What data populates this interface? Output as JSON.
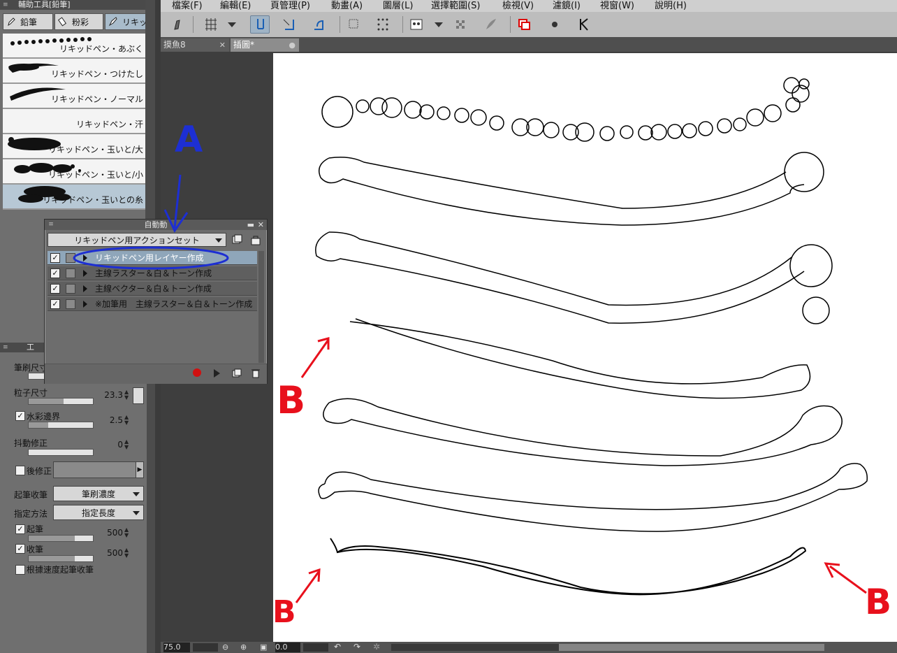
{
  "subtool_panel": {
    "title": "輔助工具[鉛筆]",
    "tabs": [
      {
        "label": "鉛筆",
        "icon": "pencil-icon"
      },
      {
        "label": "粉彩",
        "icon": "pastel-icon"
      },
      {
        "label": "リキッ",
        "icon": "liquid-pen-icon"
      }
    ],
    "brushes": [
      {
        "name": "リキッドペン・あぶく"
      },
      {
        "name": "リキッドペン・つけたし"
      },
      {
        "name": "リキッドペン・ノーマル"
      },
      {
        "name": "リキッドペン・汗"
      },
      {
        "name": "リキッドペン・玉いと/大"
      },
      {
        "name": "リキッドペン・玉いと/小"
      },
      {
        "name": "リキッドペン・玉いとの糸"
      }
    ]
  },
  "tool_property": {
    "title": "工",
    "brush_size_label": "筆刷尺寸",
    "particle_size_label": "粒子尺寸",
    "particle_size_value": "23.3",
    "watercolor_edge_label": "水彩邊界",
    "watercolor_edge_value": "2.5",
    "stabilization_label": "抖動修正",
    "stabilization_value": "0",
    "post_correction_label": "後修正",
    "taper_label": "起筆收筆",
    "taper_value": "筆刷濃度",
    "method_label": "指定方法",
    "method_value": "指定長度",
    "start_label": "起筆",
    "start_value": "500",
    "end_label": "收筆",
    "end_value": "500",
    "speed_taper_label": "根據速度起筆收筆"
  },
  "menubar": [
    "檔案(F)",
    "編輯(E)",
    "頁管理(P)",
    "動畫(A)",
    "圖層(L)",
    "選擇範圍(S)",
    "檢視(V)",
    "濾鏡(I)",
    "視窗(W)",
    "說明(H)"
  ],
  "doc_tabs": [
    {
      "label": "摸魚8",
      "active": false
    },
    {
      "label": "插圖*",
      "active": true
    }
  ],
  "auto_action": {
    "title": "自動動",
    "set_name": "リキッドペン用アクションセット",
    "actions": [
      {
        "label": "リキッドペン用レイヤー作成",
        "selected": true
      },
      {
        "label": "主線ラスター＆白＆トーン作成",
        "selected": false
      },
      {
        "label": "主線ベクター＆白＆トーン作成",
        "selected": false
      },
      {
        "label": "※加筆用　主線ラスター＆白＆トーン作成",
        "selected": false
      }
    ]
  },
  "status": {
    "zoom": "75.0",
    "angle": "0.0"
  },
  "annotations": {
    "a_label": "A",
    "b_label": "B"
  },
  "colors": {
    "annotation_blue": "#1d2fd3",
    "annotation_red": "#e8101c",
    "selection_blue": "#8fa6ba"
  }
}
